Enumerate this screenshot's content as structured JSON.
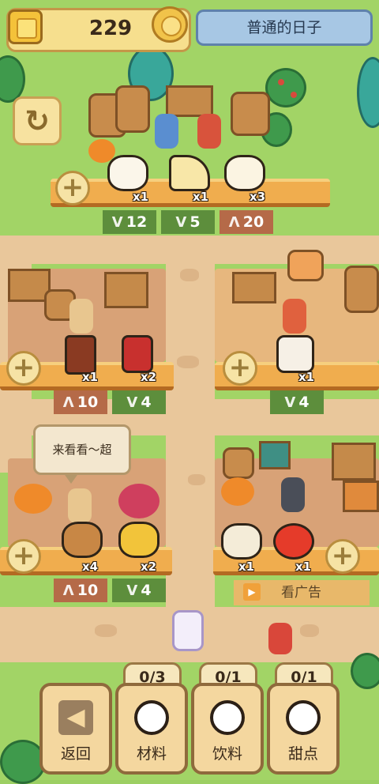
{
  "header": {
    "coins": "229",
    "day_label": "普通的日子"
  },
  "colors": {
    "grass": "#a2d466",
    "path": "#e9c79b",
    "counter": "#f0ad4e",
    "stat_green": "#5d8e3c",
    "stat_red": "#b56a48",
    "day_panel": "#a7c7e4"
  },
  "shops": {
    "top": {
      "items": [
        {
          "name": "egg-icon",
          "qty": "x1"
        },
        {
          "name": "cheese-icon",
          "qty": "x1"
        },
        {
          "name": "coffee-cup-icon",
          "qty": "x3"
        }
      ],
      "stats": [
        {
          "icon": "v-icon",
          "value": "12"
        },
        {
          "icon": "v-icon",
          "value": "5"
        },
        {
          "icon": "a-icon",
          "value": "20"
        }
      ]
    },
    "mid_left": {
      "items": [
        {
          "name": "soy-sauce-bottle-icon",
          "qty": "x1"
        },
        {
          "name": "jam-jar-icon",
          "qty": "x2"
        }
      ],
      "stats": [
        {
          "icon": "a-icon",
          "value": "10"
        },
        {
          "icon": "v-icon",
          "value": "4"
        }
      ]
    },
    "mid_right": {
      "items": [
        {
          "name": "candy-cane-icon",
          "qty": "x1"
        }
      ],
      "stats": [
        {
          "icon": "v-icon",
          "value": "4"
        }
      ]
    },
    "bottom_left": {
      "bubble": "来看看～超",
      "items": [
        {
          "name": "bread-icon",
          "qty": "x4"
        },
        {
          "name": "lemon-icon",
          "qty": "x2"
        }
      ],
      "stats": [
        {
          "icon": "a-icon",
          "value": "10"
        },
        {
          "icon": "v-icon",
          "value": "4"
        }
      ]
    },
    "bottom_right": {
      "items": [
        {
          "name": "pot-icon",
          "qty": "x1"
        },
        {
          "name": "tomato-icon",
          "qty": "x1"
        }
      ],
      "ad_label": "看广告"
    }
  },
  "bottom_bar": {
    "back": {
      "label": "返回"
    },
    "ingredients": {
      "label": "材料",
      "slots": "0/3"
    },
    "drinks": {
      "label": "饮料",
      "slots": "0/1"
    },
    "desserts": {
      "label": "甜点",
      "slots": "0/1"
    }
  }
}
